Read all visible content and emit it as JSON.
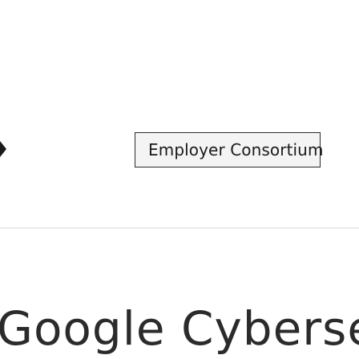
{
  "filter": {
    "selected_label": "Employer Consortium"
  },
  "section": {
    "heading": "Google Cybersecurity"
  }
}
